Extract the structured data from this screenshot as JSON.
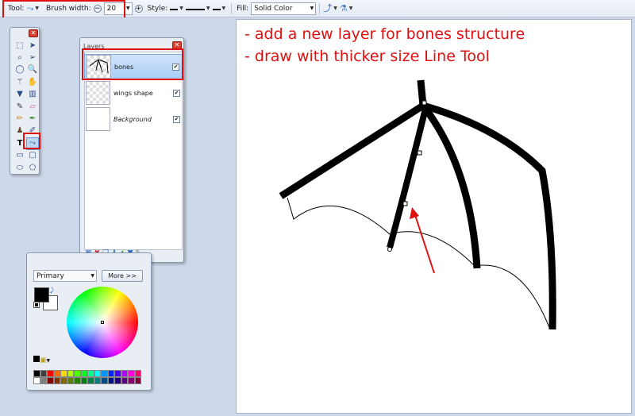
{
  "toolbar": {
    "tool_label": "Tool:",
    "brush_width_label": "Brush width:",
    "brush_width_value": "20",
    "style_label": "Style:",
    "fill_label": "Fill:",
    "fill_value": "Solid Color"
  },
  "annotations": {
    "line1": "- add a new layer for bones structure",
    "line2": "- draw with thicker size Line Tool"
  },
  "layers_panel": {
    "title": "Layers",
    "layers": [
      {
        "name": "bones",
        "visible": true,
        "selected": true
      },
      {
        "name": "wings shape",
        "visible": true,
        "selected": false
      },
      {
        "name": "Background",
        "visible": true,
        "selected": false
      }
    ]
  },
  "colors_panel": {
    "mode": "Primary",
    "more_label": "More >>",
    "primary_color": "#000000",
    "secondary_color": "#ffffff"
  },
  "accent_colors": {
    "annotation": "#e01010",
    "selection": "#a9cdf7"
  },
  "palette": [
    "#000000",
    "#404040",
    "#ff0000",
    "#ff6a00",
    "#ffd800",
    "#b6ff00",
    "#4cff00",
    "#00ff21",
    "#00ff90",
    "#00ffff",
    "#0094ff",
    "#0026ff",
    "#4800ff",
    "#b200ff",
    "#ff00dc",
    "#ff006e",
    "#ffffff",
    "#808080",
    "#7f0000",
    "#7f3300",
    "#7f6a00",
    "#5b7f00",
    "#267f00",
    "#007f0e",
    "#007f46",
    "#007f7f",
    "#004a7f",
    "#00137f",
    "#21007f",
    "#57007f",
    "#7f006e",
    "#7f0037"
  ]
}
